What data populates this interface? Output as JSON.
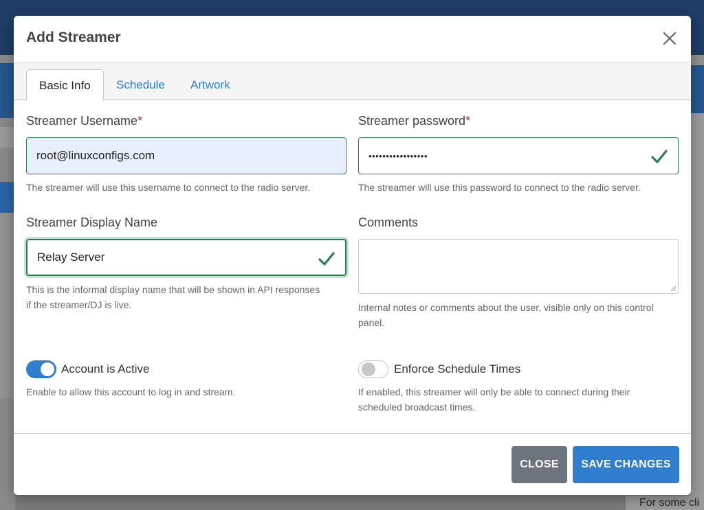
{
  "modal": {
    "title": "Add Streamer",
    "close_icon": "close-icon"
  },
  "tabs": [
    {
      "label": "Basic Info",
      "active": true
    },
    {
      "label": "Schedule",
      "active": false
    },
    {
      "label": "Artwork",
      "active": false
    }
  ],
  "form": {
    "username": {
      "label": "Streamer Username",
      "required_mark": "*",
      "value": "root@linuxconfigs.com",
      "help": "The streamer will use this username to connect to the radio server."
    },
    "password": {
      "label": "Streamer password",
      "required_mark": "*",
      "value": "•••••••••••••••••",
      "help": "The streamer will use this password to connect to the radio server."
    },
    "display_name": {
      "label": "Streamer Display Name",
      "value": "Relay Server",
      "help_line1": "This is the informal display name that will be shown in API responses",
      "help_line2": "if the streamer/DJ is live."
    },
    "comments": {
      "label": "Comments",
      "value": "",
      "help_line1": "Internal notes or comments about the user, visible only on this control",
      "help_line2": "panel."
    },
    "account_active": {
      "label": "Account is Active",
      "checked": true,
      "help": "Enable to allow this account to log in and stream."
    },
    "enforce_schedule": {
      "label": "Enforce Schedule Times",
      "checked": false,
      "help_line1": "If enabled, this streamer will only be able to connect during their",
      "help_line2": "scheduled broadcast times."
    }
  },
  "buttons": {
    "close": "CLOSE",
    "save": "SAVE CHANGES"
  },
  "background": {
    "bottom_text": "For some cli"
  },
  "colors": {
    "primary": "#2f7dce",
    "success": "#2f7d4f",
    "secondary": "#6c757d",
    "required": "#c0392b"
  }
}
